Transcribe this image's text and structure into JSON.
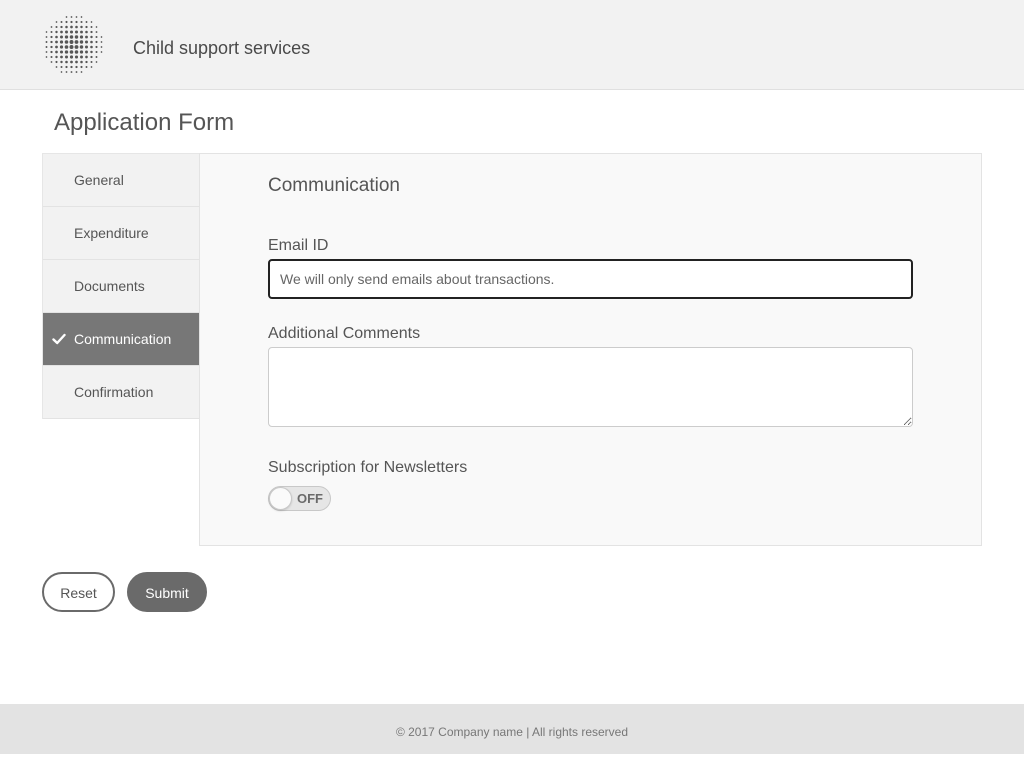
{
  "header": {
    "logo_icon": "dotted-globe-icon",
    "site_title": "Child support services"
  },
  "page": {
    "title": "Application Form"
  },
  "sidebar": {
    "items": [
      {
        "label": "General",
        "active": false
      },
      {
        "label": "Expenditure",
        "active": false
      },
      {
        "label": "Documents",
        "active": false
      },
      {
        "label": "Communication",
        "active": true,
        "icon": "checkmark-icon"
      },
      {
        "label": "Confirmation",
        "active": false
      }
    ]
  },
  "panel": {
    "section_title": "Communication",
    "email": {
      "label": "Email ID",
      "value": "",
      "placeholder": "We will only send emails about transactions."
    },
    "comments": {
      "label": "Additional Comments",
      "value": ""
    },
    "newsletter": {
      "label": "Subscription for Newsletters",
      "state": "OFF"
    }
  },
  "actions": {
    "reset_label": "Reset",
    "submit_label": "Submit"
  },
  "footer": {
    "text": "© 2017 Company name | All rights reserved"
  },
  "colors": {
    "header_bg": "#f2f2f2",
    "active_item_bg": "#777777",
    "submit_bg": "#6a6a6a",
    "footer_bg": "#e3e3e3"
  }
}
